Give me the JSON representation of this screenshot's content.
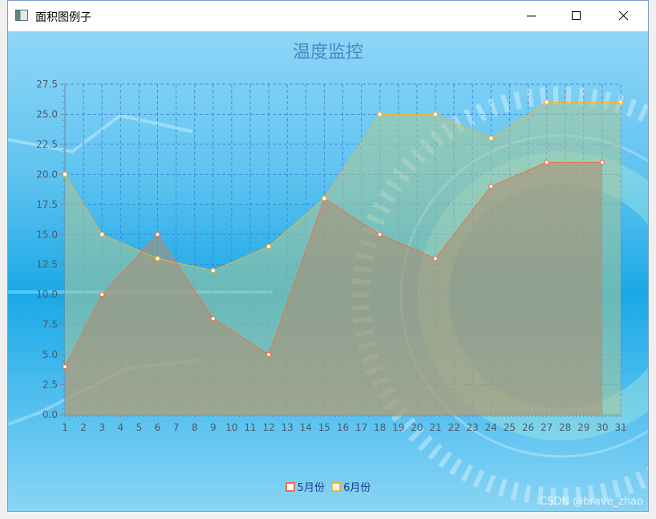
{
  "window": {
    "title": "面积图例子",
    "min_label": "minimize",
    "max_label": "maximize",
    "close_label": "close"
  },
  "watermark": "CSDN @brave_zhao",
  "colors": {
    "series1": "#e8734a",
    "series2": "#f0b23a"
  },
  "chart_data": {
    "type": "area",
    "title": "温度监控",
    "xlabel": "",
    "ylabel": "",
    "x": [
      1,
      2,
      3,
      4,
      5,
      6,
      7,
      8,
      9,
      10,
      11,
      12,
      13,
      14,
      15,
      16,
      17,
      18,
      19,
      20,
      21,
      22,
      23,
      24,
      25,
      26,
      27,
      28,
      29,
      30,
      31
    ],
    "xlim": [
      1,
      31
    ],
    "ylim": [
      0,
      27.5
    ],
    "yticks": [
      "0.0",
      "2.5",
      "5.0",
      "7.5",
      "10.0",
      "12.5",
      "15.0",
      "17.5",
      "20.0",
      "22.5",
      "25.0",
      "27.5"
    ],
    "grid": true,
    "legend": "bottom-center",
    "series": [
      {
        "name": "5月份",
        "points": [
          [
            1,
            4
          ],
          [
            3,
            10
          ],
          [
            6,
            15
          ],
          [
            9,
            8
          ],
          [
            12,
            5
          ],
          [
            15,
            18
          ],
          [
            18,
            15
          ],
          [
            21,
            13
          ],
          [
            24,
            19
          ],
          [
            27,
            21
          ],
          [
            30,
            21
          ]
        ]
      },
      {
        "name": "6月份",
        "points": [
          [
            1,
            20
          ],
          [
            3,
            15
          ],
          [
            6,
            13
          ],
          [
            9,
            12
          ],
          [
            12,
            14
          ],
          [
            15,
            18
          ],
          [
            18,
            25
          ],
          [
            21,
            25
          ],
          [
            24,
            23
          ],
          [
            27,
            26
          ],
          [
            31,
            26
          ]
        ]
      }
    ]
  }
}
